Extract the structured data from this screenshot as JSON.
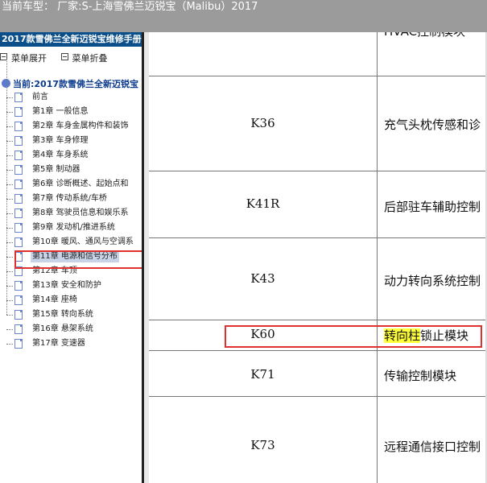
{
  "topbar": {
    "title": "当前车型： 厂家:S-上海雪佛兰迈锐宝（Malibu）2017"
  },
  "sidebar": {
    "title": "2017款雪佛兰全新迈锐宝维修手册",
    "expand_label": "菜单展开",
    "collapse_label": "菜单折叠",
    "root": "当前:2017款雪佛兰全新迈锐宝",
    "items": [
      {
        "label": "前言"
      },
      {
        "label": "第1章 一般信息"
      },
      {
        "label": "第2章 车身金属构件和装饰"
      },
      {
        "label": "第3章 车身修理"
      },
      {
        "label": "第4章 车身系统"
      },
      {
        "label": "第5章 制动器"
      },
      {
        "label": "第6章 诊断概述、起始点和"
      },
      {
        "label": "第7章 传动系统/车桥"
      },
      {
        "label": "第8章 驾驶员信息和娱乐系"
      },
      {
        "label": "第9章 发动机/推进系统"
      },
      {
        "label": "第10章 暖风、通风与空调系"
      },
      {
        "label": "第11章 电源和信号分布"
      },
      {
        "label": "第12章 车顶"
      },
      {
        "label": "第13章 安全和防护"
      },
      {
        "label": "第14章 座椅"
      },
      {
        "label": "第15章 转向系统"
      },
      {
        "label": "第16章 悬架系统"
      },
      {
        "label": "第17章 变速器"
      }
    ]
  },
  "table": {
    "rows": [
      {
        "code": "K36",
        "desc": "充气头枕传感和诊"
      },
      {
        "code": "K41R",
        "desc": "后部驻车辅助控制"
      },
      {
        "code": "K43",
        "desc": "动力转向系统控制"
      },
      {
        "code": "K60",
        "desc_highlight": "转向柱",
        "desc_rest": "锁止模块"
      },
      {
        "code": "K71",
        "desc": "传输控制模块"
      },
      {
        "code": "K73",
        "desc": "远程通信接口控制"
      }
    ],
    "partial_top": "HVAC控制模块"
  }
}
